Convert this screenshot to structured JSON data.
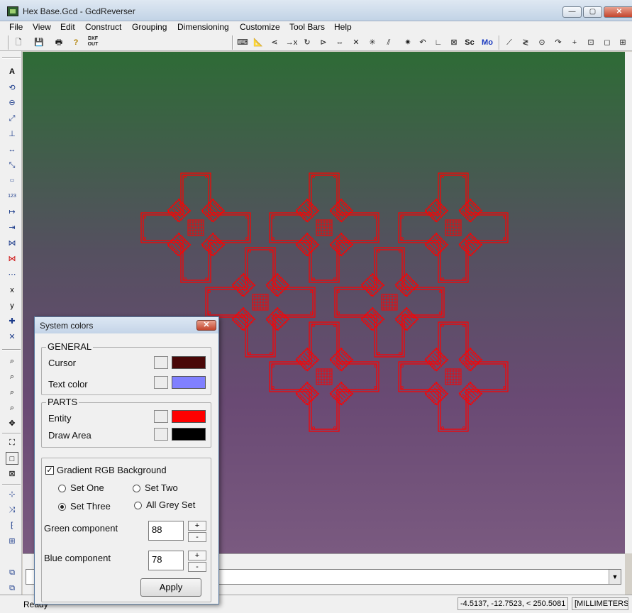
{
  "window": {
    "title": "Hex Base.Gcd - GcdReverser",
    "min_label": "—",
    "max_label": "▢",
    "close_label": "✕"
  },
  "menu": [
    "File",
    "View",
    "Edit",
    "Construct",
    "Grouping",
    "Dimensioning",
    "Customize",
    "Tool Bars",
    "Help"
  ],
  "toolbar": {
    "file_buttons": [
      "new-file-icon",
      "save-icon",
      "print-icon",
      "help-icon",
      "dxf-out-icon"
    ],
    "dxf_label": "DXF OUT",
    "sc_label": "Sc",
    "mo_label": "Mo"
  },
  "colors": {
    "draw_gradient_top": "#2e6b36",
    "draw_gradient_bottom": "#7a5a80",
    "entity": "#ff0000",
    "cursor": "#4a0808",
    "text_color": "#8080ff",
    "draw_area": "#000000"
  },
  "status": {
    "text": "Ready",
    "coords": "-4.5137, -12.7523, < 250.5081",
    "units": "[MILLIMETERS]"
  },
  "dialog": {
    "title": "System colors",
    "general_label": "GENERAL",
    "cursor_label": "Cursor",
    "text_color_label": "Text color",
    "parts_label": "PARTS",
    "entity_label": "Entity",
    "draw_area_label": "Draw Area",
    "gradient_label": "Gradient RGB Background",
    "gradient_checked": true,
    "set_one": "Set One",
    "set_two": "Set Two",
    "set_three": "Set Three",
    "all_grey": "All Grey Set",
    "selected_set": "Set Three",
    "green_label": "Green component",
    "green_value": "88",
    "blue_label": "Blue component",
    "blue_value": "78",
    "plus": "+",
    "minus": "-",
    "apply": "Apply"
  }
}
